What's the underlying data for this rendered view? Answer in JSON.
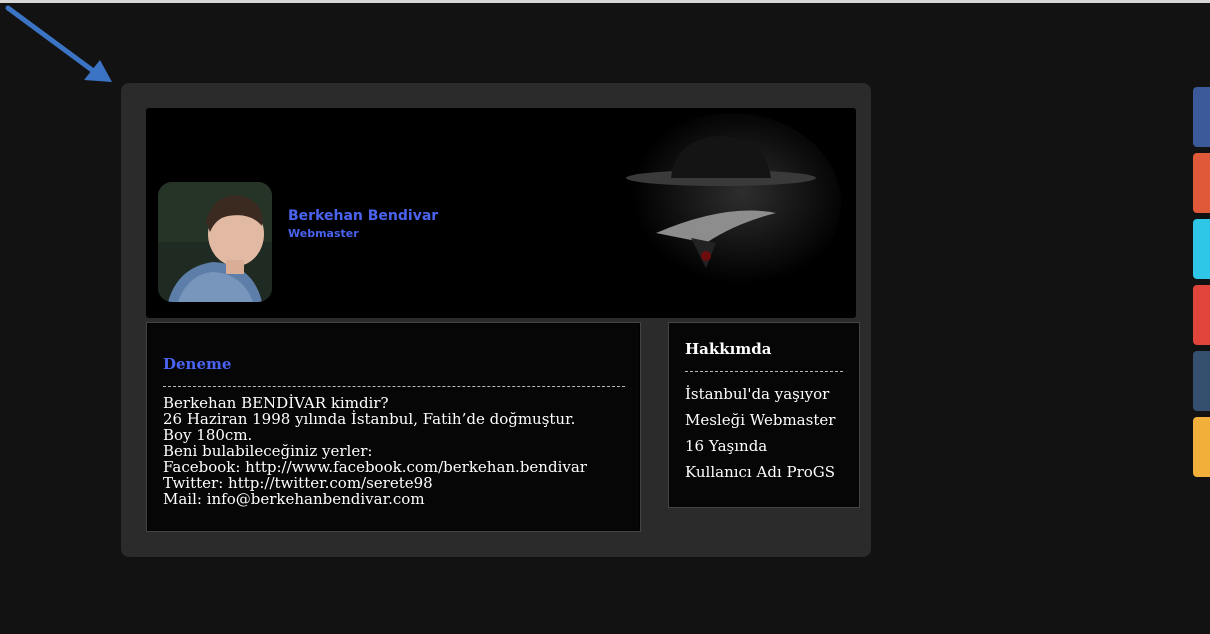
{
  "profile": {
    "name": "Berkehan Bendivar",
    "role": "Webmaster"
  },
  "post": {
    "title": "Deneme",
    "lines": [
      "Berkehan BENDİVAR kimdir?",
      "26 Haziran 1998 yılında İstanbul, Fatih’de doğmuştur.",
      "Boy 180cm.",
      "Beni bulabileceğiniz yerler:",
      "Facebook: http://www.facebook.com/berkehan.bendivar",
      "Twitter: http://twitter.com/serete98",
      "Mail: info@berkehanbendivar.com"
    ]
  },
  "about": {
    "title": "Hakkımda",
    "items": [
      "İstanbul'da yaşıyor",
      "Mesleği Webmaster",
      "16 Yaşında",
      "Kullanıcı Adı ProGS"
    ]
  },
  "social_tabs": [
    {
      "name": "social-tab-facebook",
      "color": "#3c5a99"
    },
    {
      "name": "social-tab-orange",
      "color": "#e05a3a"
    },
    {
      "name": "social-tab-twitter",
      "color": "#2fc7e8"
    },
    {
      "name": "social-tab-google",
      "color": "#e0443a"
    },
    {
      "name": "social-tab-tumblr",
      "color": "#35506e"
    },
    {
      "name": "social-tab-rss",
      "color": "#f2b03a"
    }
  ],
  "colors": {
    "accent": "#4a63f0",
    "background": "#121212",
    "panel": "#2b2b2b"
  }
}
